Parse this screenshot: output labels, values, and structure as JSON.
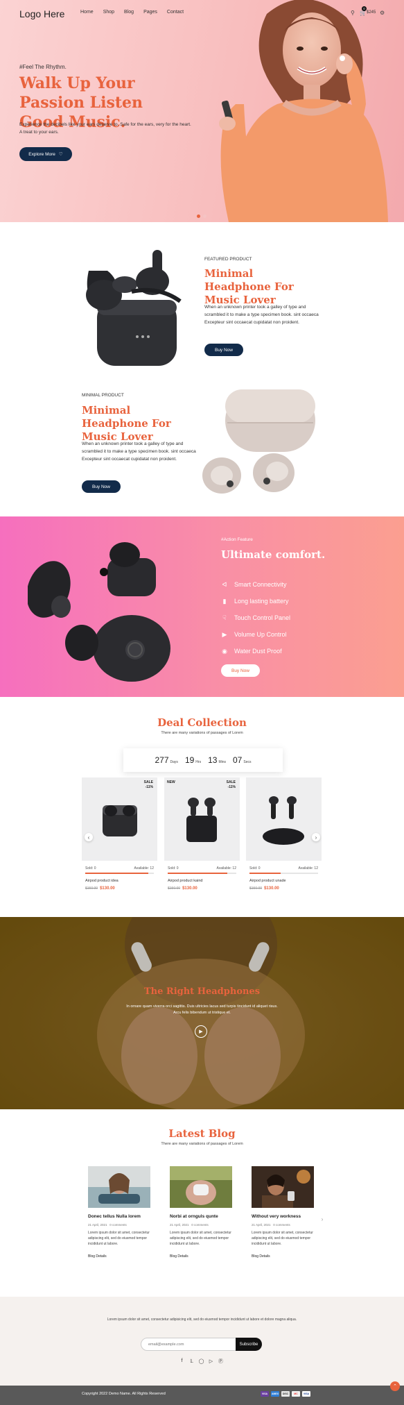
{
  "header": {
    "logo": "Logo Here",
    "nav": [
      "Home",
      "Shop",
      "Blog",
      "Pages",
      "Contact"
    ],
    "cart_count": "0",
    "cart_total": "$245"
  },
  "hero": {
    "tagline": "#Feel The Rhythm.",
    "title": "Walk Up Your Passion Listen Good Music.",
    "description": "Experience the decibels like your ears deserve to. Safe for the ears, very for the heart. A treat to your ears.",
    "button": "Explore More"
  },
  "featured": {
    "label": "FEATURED PRODUCT",
    "title": "Minimal Headphone For Music Lover",
    "description": "When an unknown printer took a galley of type and scrambled it to make a type specimen book. sint occaeca Excepteur sint occaecat cupidatat non proident.",
    "button": "Buy Now"
  },
  "minimal": {
    "label": "MINIMAL PRODUCT",
    "title": "Minimal Headphone For Music Lover",
    "description": "When an unknown printer took a galley of type and scrambled it to make a type specimen book. sint occaeca Excepteur sint occaecat cupidatat non proident.",
    "button": "Buy Now"
  },
  "action": {
    "label": "#Action Feature",
    "title": "Ultimate comfort.",
    "features": [
      "Smart Connectivity",
      "Long lasting battery",
      "Touch Control Panel",
      "Volume Up Control",
      "Water Dust Proof"
    ],
    "button": "Buy Now"
  },
  "deal": {
    "title": "Deal Collection",
    "subtitle": "There are many variations of passages of Lorem",
    "countdown": [
      {
        "value": "277",
        "unit": "Days"
      },
      {
        "value": "19",
        "unit": "Hrs"
      },
      {
        "value": "13",
        "unit": "Mins"
      },
      {
        "value": "07",
        "unit": "Secs"
      }
    ],
    "products": [
      {
        "badge": "SALE",
        "discount": "-11%",
        "sold": "Sold: 0",
        "available": "Available: 12",
        "progress": 0.92,
        "name": "Airpod product idea",
        "old_price": "$150.00",
        "price": "$130.00"
      },
      {
        "badge_left": "NEW",
        "badge": "SALE",
        "discount": "-11%",
        "sold": "Sold: 0",
        "available": "Available: 12",
        "progress": 0.87,
        "name": "Airpod product kaind",
        "old_price": "$150.00",
        "price": "$130.00"
      },
      {
        "sold": "Sold: 0",
        "available": "Available: 12",
        "progress": 0.45,
        "name": "Airpod product unade",
        "old_price": "$150.00",
        "price": "$130.00"
      }
    ]
  },
  "video": {
    "title": "The Right Headphones",
    "description": "In ornare quam viverra orci sagittis. Duis ultricies lacus sed turpis tincidunt id aliquet risus. Arcu felis bibendum ut tristique et."
  },
  "blog": {
    "title": "Latest Blog",
    "subtitle": "There are many variations of passages of Lorem",
    "posts": [
      {
        "title": "Donec tellus Nulla lorem",
        "date": "21 April, 2021",
        "comments": "0 comments",
        "excerpt": "Lorem ipsum dolor sit amet, consectetur adipiscing elit, sed do eiusmod tempor incididunt ut labore.",
        "link": "Blog Details"
      },
      {
        "title": "Norbi at ornguls qunte",
        "date": "21 April, 2021",
        "comments": "0 comments",
        "excerpt": "Lorem ipsum dolor sit amet, consectetur adipiscing elit, sed do eiusmod tempor incididunt ut labore.",
        "link": "Blog Details"
      },
      {
        "title": "Without very workness",
        "date": "21 April, 2021",
        "comments": "0 comments",
        "excerpt": "Lorem ipsum dolor sit amet, consectetur adipiscing elit, sed do eiusmod tempor incididunt ut labore.",
        "link": "Blog Details"
      }
    ]
  },
  "footer": {
    "newsletter_text": "Lorem ipsum dolor sit amet, consectetur adipisicing elit, sed do eiusmod tempor incididunt ut labore et dolore magna aliqua.",
    "email_placeholder": "email@example.com",
    "subscribe": "Subscribe",
    "socials": [
      "facebook-icon",
      "twitter-icon",
      "instagram-icon",
      "youtube-icon",
      "pinterest-icon"
    ],
    "copyright": "Copyright 2022 Demo Name. All Rights Reserved",
    "payments": [
      "VISA",
      "AMEX",
      "DISC",
      "MC",
      "VISA"
    ]
  },
  "colors": {
    "accent": "#e8633d",
    "navy": "#122b4a"
  }
}
